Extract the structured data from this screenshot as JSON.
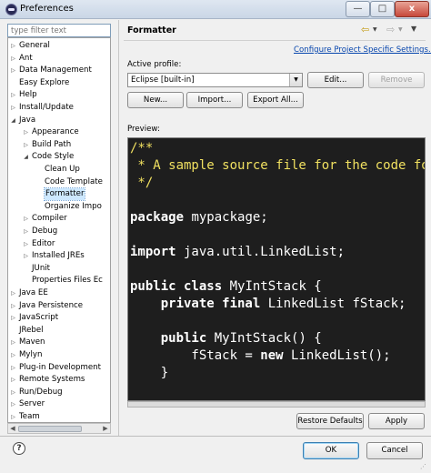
{
  "window": {
    "title": "Preferences",
    "min_symbol": "—",
    "max_symbol": "□",
    "close_symbol": "x"
  },
  "filter": {
    "placeholder": "type filter text"
  },
  "tree": {
    "items": [
      {
        "label": "General",
        "level": 0,
        "expander": "▷",
        "selected": false
      },
      {
        "label": "Ant",
        "level": 0,
        "expander": "▷",
        "selected": false
      },
      {
        "label": "Data Management",
        "level": 0,
        "expander": "▷",
        "selected": false
      },
      {
        "label": "Easy Explore",
        "level": 0,
        "expander": "",
        "selected": false
      },
      {
        "label": "Help",
        "level": 0,
        "expander": "▷",
        "selected": false
      },
      {
        "label": "Install/Update",
        "level": 0,
        "expander": "▷",
        "selected": false
      },
      {
        "label": "Java",
        "level": 0,
        "expander": "◢",
        "selected": false
      },
      {
        "label": "Appearance",
        "level": 1,
        "expander": "▷",
        "selected": false
      },
      {
        "label": "Build Path",
        "level": 1,
        "expander": "▷",
        "selected": false
      },
      {
        "label": "Code Style",
        "level": 1,
        "expander": "◢",
        "selected": false
      },
      {
        "label": "Clean Up",
        "level": 2,
        "expander": "",
        "selected": false
      },
      {
        "label": "Code Template",
        "level": 2,
        "expander": "",
        "selected": false
      },
      {
        "label": "Formatter",
        "level": 2,
        "expander": "",
        "selected": true
      },
      {
        "label": "Organize Impo",
        "level": 2,
        "expander": "",
        "selected": false
      },
      {
        "label": "Compiler",
        "level": 1,
        "expander": "▷",
        "selected": false
      },
      {
        "label": "Debug",
        "level": 1,
        "expander": "▷",
        "selected": false
      },
      {
        "label": "Editor",
        "level": 1,
        "expander": "▷",
        "selected": false
      },
      {
        "label": "Installed JREs",
        "level": 1,
        "expander": "▷",
        "selected": false
      },
      {
        "label": "JUnit",
        "level": 1,
        "expander": "",
        "selected": false
      },
      {
        "label": "Properties Files Ec",
        "level": 1,
        "expander": "",
        "selected": false
      },
      {
        "label": "Java EE",
        "level": 0,
        "expander": "▷",
        "selected": false
      },
      {
        "label": "Java Persistence",
        "level": 0,
        "expander": "▷",
        "selected": false
      },
      {
        "label": "JavaScript",
        "level": 0,
        "expander": "▷",
        "selected": false
      },
      {
        "label": "JRebel",
        "level": 0,
        "expander": "",
        "selected": false
      },
      {
        "label": "Maven",
        "level": 0,
        "expander": "▷",
        "selected": false
      },
      {
        "label": "Mylyn",
        "level": 0,
        "expander": "▷",
        "selected": false
      },
      {
        "label": "Plug-in Development",
        "level": 0,
        "expander": "▷",
        "selected": false
      },
      {
        "label": "Remote Systems",
        "level": 0,
        "expander": "▷",
        "selected": false
      },
      {
        "label": "Run/Debug",
        "level": 0,
        "expander": "▷",
        "selected": false
      },
      {
        "label": "Server",
        "level": 0,
        "expander": "▷",
        "selected": false
      },
      {
        "label": "Team",
        "level": 0,
        "expander": "▷",
        "selected": false
      }
    ]
  },
  "page": {
    "title": "Formatter",
    "config_link": "Configure Project Specific Settings...",
    "active_profile_label": "Active profile:",
    "profile_value": "Eclipse [built-in]",
    "edit_label": "Edit...",
    "remove_label": "Remove",
    "new_label": "New...",
    "import_label": "Import...",
    "export_label": "Export All...",
    "preview_label": "Preview:",
    "restore_label": "Restore Defaults",
    "apply_label": "Apply"
  },
  "preview_lines": [
    [
      {
        "t": "/**",
        "s": "c"
      }
    ],
    [
      {
        "t": " * A sample source file for the code formatter preview",
        "s": "c"
      }
    ],
    [
      {
        "t": " */",
        "s": "c"
      }
    ],
    [
      {
        "t": "",
        "s": ""
      }
    ],
    [
      {
        "t": "package",
        "s": "k"
      },
      {
        "t": " mypackage;",
        "s": ""
      }
    ],
    [
      {
        "t": "",
        "s": ""
      }
    ],
    [
      {
        "t": "import",
        "s": "k"
      },
      {
        "t": " java.util.LinkedList;",
        "s": ""
      }
    ],
    [
      {
        "t": "",
        "s": ""
      }
    ],
    [
      {
        "t": "public class",
        "s": "k"
      },
      {
        "t": " MyIntStack {",
        "s": ""
      }
    ],
    [
      {
        "t": "    ",
        "s": ""
      },
      {
        "t": "private final",
        "s": "k"
      },
      {
        "t": " LinkedList fStack;",
        "s": ""
      }
    ],
    [
      {
        "t": "",
        "s": ""
      }
    ],
    [
      {
        "t": "    ",
        "s": ""
      },
      {
        "t": "public",
        "s": "k"
      },
      {
        "t": " MyIntStack() {",
        "s": ""
      }
    ],
    [
      {
        "t": "        fStack = ",
        "s": ""
      },
      {
        "t": "new",
        "s": "k"
      },
      {
        "t": " LinkedList();",
        "s": ""
      }
    ],
    [
      {
        "t": "    }",
        "s": ""
      }
    ]
  ],
  "dialog": {
    "ok_label": "OK",
    "cancel_label": "Cancel",
    "help_symbol": "?"
  },
  "icons": {
    "back": "back-arrow-icon",
    "forward": "forward-arrow-icon",
    "menu": "view-menu-icon",
    "help": "help-icon",
    "app": "eclipse-icon"
  },
  "colors": {
    "preview_bg": "#1e1e1e",
    "comment": "#f0e060",
    "selection": "#cde8ff",
    "link": "#0645ad"
  }
}
